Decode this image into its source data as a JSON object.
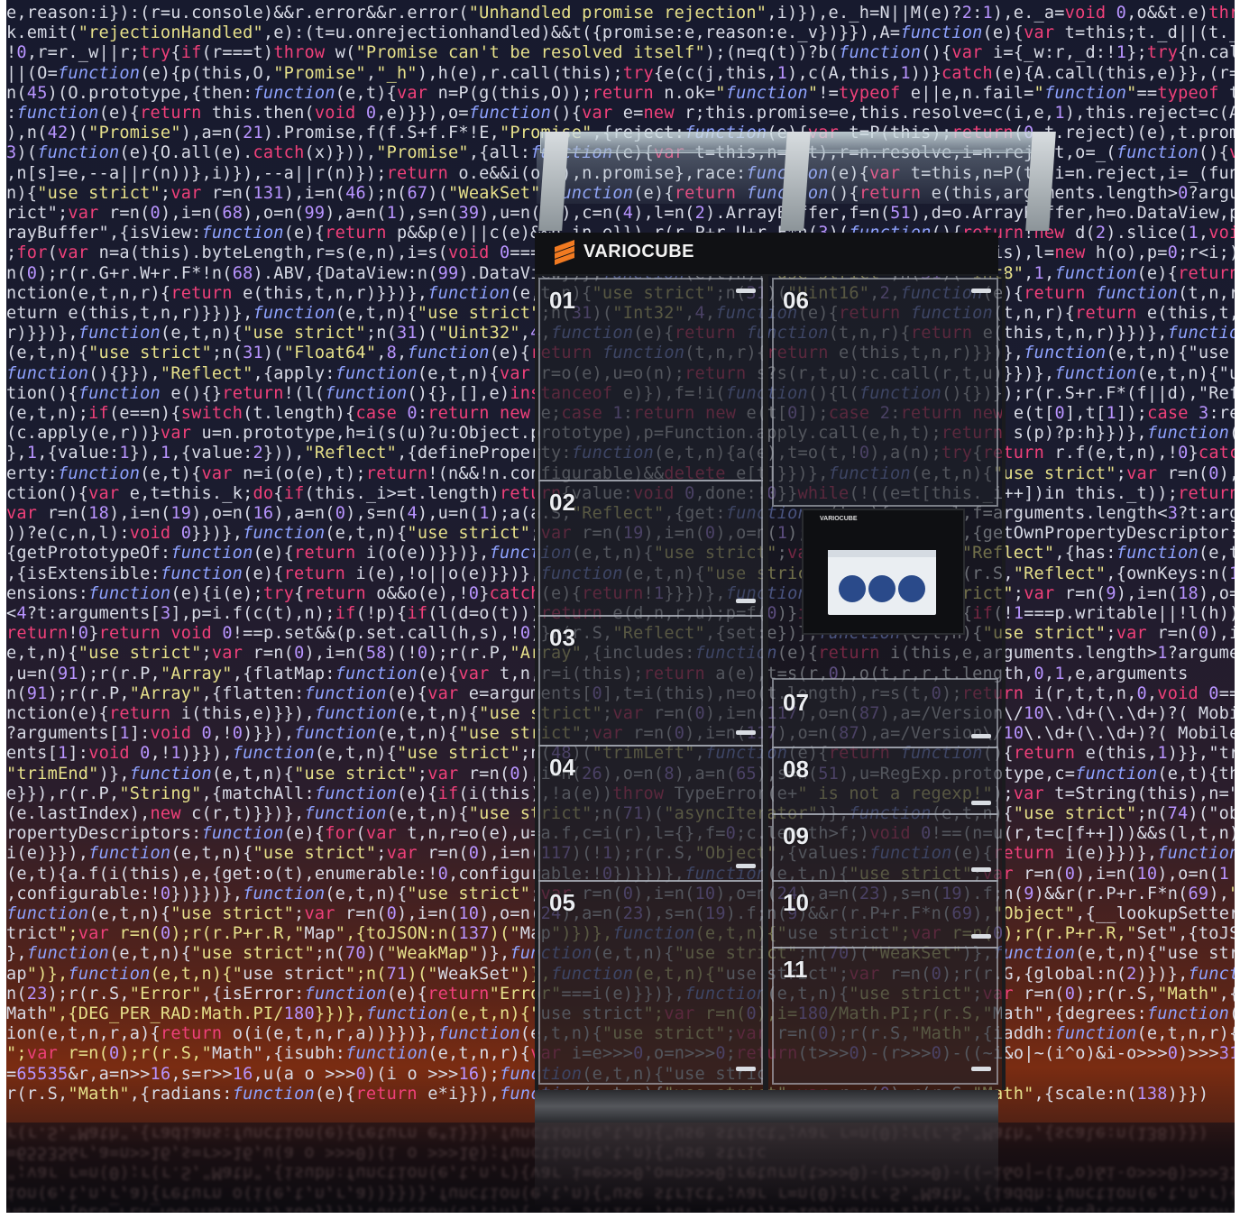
{
  "brand": {
    "name": "VARIOCUBE"
  },
  "screen": {
    "brand": "VARIOCUBE"
  },
  "doors": [
    "01",
    "02",
    "03",
    "04",
    "05",
    "06",
    "07",
    "08",
    "09",
    "10",
    "11"
  ],
  "colors": {
    "brand_orange": "#f17a21",
    "code_keyword": "#f0407a",
    "code_function": "#8fa3ff"
  },
  "code_lines": [
    "e,reason:i}):(r=u.console)&&r.error&&r.error(\"Unhandled promise rejection\",i)}),e._h=N||M(e)?2:1),e._a=void 0,o&&t.e)throw",
    "k.emit(\"rejectionHandled\",e):(t=u.onrejectionhandled)&&t({promise:e,reason:e._v})}}),A=function(e){var t=this;t._d||(t._d=",
    "!0,r=r._w||r;try{if(r===t)throw w(\"Promise can't be resolved itself\");(n=q(t))?b(function(){var i={_w:r,_d:!1};try{n.call",
    "||(O=function(e){p(this,O,\"Promise\",\"_h\"),h(e),r.call(this);try{e(c(j,this,1),c(A,this,1))}catch(e){A.call(this,e)}},(r=fu",
    "n(45)(O.prototype,{then:function(e,t){var n=P(g(this,O));return n.ok=\"function\"!=typeof e||e,n.fail=\"function\"==typeof t",
    ":function(e){return this.then(void 0,e)}}),o=function(){var e=new r;this.promise=e,this.resolve=c(i,e,1),this.reject=c(A,e",
    "),n(42)(\"Promise\"),a=n(21).Promise,f(f.S+f.F*!E,\"Promise\",{reject:function(e){var t=P(this);return(0,t.reject)(e),t.promise",
    "3)(function(e){O.all(e).catch(x)})),\"Promise\",{all:function(e){var t=this,n=P(t),r=n.resolve,i=n.reject,o=_(function(){var",
    ",n[s]=e,--a||r(n))},i)}),--a||r(n)});return o.e&&i(o.v),n.promise},race:function(e){var t=this,n=P(t),i=n.reject,i=_(funct",
    "n){\"use strict\";var r=n(131),i=n(46);n(67)(\"WeakSet\",function(e){return function(){return e(this,arguments.length>0?argumen",
    "rict\";var r=n(0),i=n(68),o=n(99),a=n(1),s=n(39),u=n(33),c=n(4),l=n(2).ArrayBuffer,f=n(51),d=o.ArrayBuffer,h=o.DataView,p=i.A",
    "rayBuffer\",{isView:function(e){return p&&p(e)||c(e)&&h in e}}),r(r.P+r.U+r.F*n(3)(function(){return!new d(2).slice(1,void 0",
    ";for(var n=a(this).byteLength,r=s(e,n),i=s(void 0===t?n:t,n),o=new(f(this,d))(u(i-r)),c=new h(this),l=new h(o),p=0;r<i;)l.s",
    "n(0);r(r.G+r.W+r.F*!n(68).ABV,{DataView:n(99).DataView})},function(e,t,n){\"use strict\";n(31)(\"Int8\",1,function(e){return fu",
    "nction(e,t,n,r){return e(this,t,n,r)}})},function(e,t,n){\"use strict\";n(31)(\"Uint16\",2,function(e){return function(t,n,r){ret",
    "eturn e(this,t,n,r)}})},function(e,t,n){\"use strict\";n(31)(\"Int32\",4,function(e){return function(t,n,r){return e(this,t,n,",
    "r)}})},function(e,t,n){\"use strict\";n(31)(\"Uint32\",4,function(e){return function(t,n,r){return e(this,t,n,r)}})},function(e",
    "(e,t,n){\"use strict\";n(31)(\"Float64\",8,function(e){return function(t,n,r){return e(this,t,n,r)}})},function(e,t,n){\"use st",
    "function(){}}),\"Reflect\",{apply:function(e,t,n){var r=o(e),u=o(n);return s?s(r,t,u):c.call(r,t,u)}})},function(e,t,n){\"use",
    "tion(){function e(){}return!(l(function(){},[],e)instanceof e)}),f=!i(function(){l(function(){})});r(r.S+r.F*(f||d),\"Reflec",
    "(e,t,n);if(e==n){switch(t.length){case 0:return new e;case 1:return new e(t[0]);case 2:return new e(t[0],t[1]);case 3:retu",
    "(c.apply(e,r))}var u=n.prototype,h=i(s(u)?u:Object.prototype),p=Function.apply.call(e,h,t);return s(p)?p:h}})},function(e",
    "},1,{value:1}),1,{value:2})),\"Reflect\",{defineProperty:function(e,t,n){a(e),t=o(t,!0),a(n);try{return r.f(e,t,n),!0}catch",
    "erty:function(e,t){var n=i(o(e),t);return!(n&&!n.configurable)&&delete e[t]}})},function(e,t,n){\"use strict\";var r=n(0),i=n",
    "ction(){var e,t=this._k;do{if(this._i>=t.length)return{value:void 0,done:!0}}while(!((e=t[this._i++])in this._t));return{va",
    "var r=n(18),i=n(19),o=n(16),a=n(0),s=n(4),u=n(1);a(a.S,\"Reflect\",{get:function e(t,n){var a,l,f=arguments.length<3?t:argume",
    "))?e(c,n,l):void 0}})},function(e,t,n){\"use strict\";var r=n(19),i=n(0),o=n(1);i(i.S,\"Reflect\",{getOwnPropertyDescriptor:fun",
    "{getPrototypeOf:function(e){return i(o(e))}})},function(e,t,n){\"use strict\";var r=n(0);r(r.S,\"Reflect\",{has:function(e,t){",
    ",{isExtensible:function(e){return i(e),!o||o(e)}})},function(e,t,n){\"use strict\";var r=n(0);r(r.S,\"Reflect\",{ownKeys:n(133",
    "ensions:function(e){i(e);try{return o&&o(e),!0}catch(e){return!1}}})},function(e,t,n){\"use strict\";var r=n(9),i=n(18),o=n(",
    "<4?t:arguments[3],p=i.f(c(t),n);if(!p){if(l(d=o(t)))return e(d,n,r,u);p=f(0)}if(s(p,\"value\")){if(!1===p.writable||!l(h))re",
    "return!0}return void 0!==p.set&&(p.set.call(h,s),!0)}r(r.S,\"Reflect\",{set:e})},function(e,t,n){\"use strict\";var r=n(0),i=n(78);i&&r(r.S,\"Reflect\",",
    "e,t,n){\"use strict\";var r=n(0),i=n(58)(!0);r(r.P,\"Array\",{includes:function(e){return i(this,e,arguments.length>1?arguments",
    ",u=n(91);r(r.P,\"Array\",{flatMap:function(e){var t,n,r=i(this);return a(e),t=s(r,0),o(t,r,r,t.length,0,1,e,arguments",
    "n(91);r(r.P,\"Array\",{flatten:function(e){var e=arguments[0],t=i(this),n=o(t.length),r=s(t,0);return i(r,t,t,n,0,void 0===e?",
    "nction(e){return i(this,e)}}),function(e,t,n){\"use strict\";var r=n(0),i=n(117),o=n(87),a=/Version\\/10\\.\\d+(\\.\\d+)?( Mobile",
    "?arguments[1]:void 0,!0)}}),function(e,t,n){\"use strict\";var r=n(0),i=n(117),o=n(87),a=/Version\\/10\\.\\d+(\\.\\d+)?( Mobile\\/",
    "ents[1]:void 0,!1)}}),function(e,t,n){\"use strict\";n(48)(\"trimLeft\",function(e){return function(){return e(this,1)}},\"trim",
    "\"trimEnd\")},function(e,t,n){\"use strict\";var r=n(0),i=n(26),o=n(8),a=n(65),s=n(51),u=RegExp.prototype,c=function(e,t){this",
    "e}}),r(r.P,\"String\",{matchAll:function(e){if(i(this),!a(e))throw TypeError(e+\" is not a regexp!\");var t=String(this),n=\"fl",
    "(e.lastIndex),new c(r,t)}})},function(e,t,n){\"use strict\";n(71)(\"asyncIterator\")},function(e,t,n){\"use strict\";n(74)(\"obse",
    "ropertyDescriptors:function(e){for(var t,n,r=o(e),u=a.f,c=i(r),l={},f=0;c.length>f;)void 0!==(n=u(r,t=c[f++]))&&s(l,t,n);",
    "i(e)}}),function(e,t,n){\"use strict\";var r=n(0),i=n(117)(!1);r(r.S,\"Object\",{values:function(e){return i(e)}})},function",
    "(e,t){a.f(i(this),e,{get:o(t),enumerable:!0,configurable:!0})}})},function(e,t,n){\"use strict\";var r=n(0),i=n(10),o=n(1",
    ",configurable:!0})}})},function(e,t,n){\"use strict\";var r=n(0),i=n(10),o=n(24),a=n(23),s=n(19).f;n(9)&&r(r.P+r.F*n(69),\"Object\"",
    "function(e,t,n){\"use strict\";var r=n(0),i=n(10),o=n(24),a=n(23),s=n(19).f;n(9)&&r(r.P+r.F*n(69),\"Object\",{__lookupSetter__:func",
    "trict\";var r=n(0);r(r.P+r.R,\"Map\",{toJSON:n(137)(\"Map\")})},function(e,t,n){\"use strict\";var r=n(0);r(r.P+r.R,\"Set\",{toJSON",
    "},function(e,t,n){\"use strict\";n(70)(\"WeakMap\")},function(e,t,n){\"use strict\";n(70)(\"WeakSet\")},function(e,t,n){\"use strict",
    "ap\")},function(e,t,n){\"use strict\";n(71)(\"WeakSet\")},function(e,t,n){\"use strict\";var r=n(0);r(r.G,{global:n(2)})},function",
    "n(23);r(r.S,\"Error\",{isError:function(e){return\"Error\"===i(e)}})},function(e,t,n){\"use strict\";var r=n(0);r(r.S,\"Math\",{cla",
    "Math\",{DEG_PER_RAD:Math.PI/180}})},function(e,t,n){\"use strict\";var r=n(0),i=180/Math.PI;r(r.S,\"Math\",{degrees:function(e){",
    "ion(e,t,n,r,a){return o(i(e,t,n,r,a))}})},function(e,t,n){\"use strict\";var r=n(0);r(r.S,\"Math\",{iaddh:function(e,t,n,r){va",
    "\";var r=n(0);r(r.S,\"Math\",{isubh:function(e,t,n,r){var i=e>>>0,o=n>>>0;return(t>>>0)-(r>>>0)-((~i&o|~(i^o)&i-o>>>0)>>>31)",
    "=65535&r,a=n>>16,s=r>>16,u(a o >>>0)(i o >>>16);function(e,t,n){\"use stric",
    "r(r.S,\"Math\",{radians:function(e){return e*i}}),function(e,t,n){\"use strict\";var r=n(0);r(r.S,\"Math\",{scale:n(138)}})"
  ]
}
